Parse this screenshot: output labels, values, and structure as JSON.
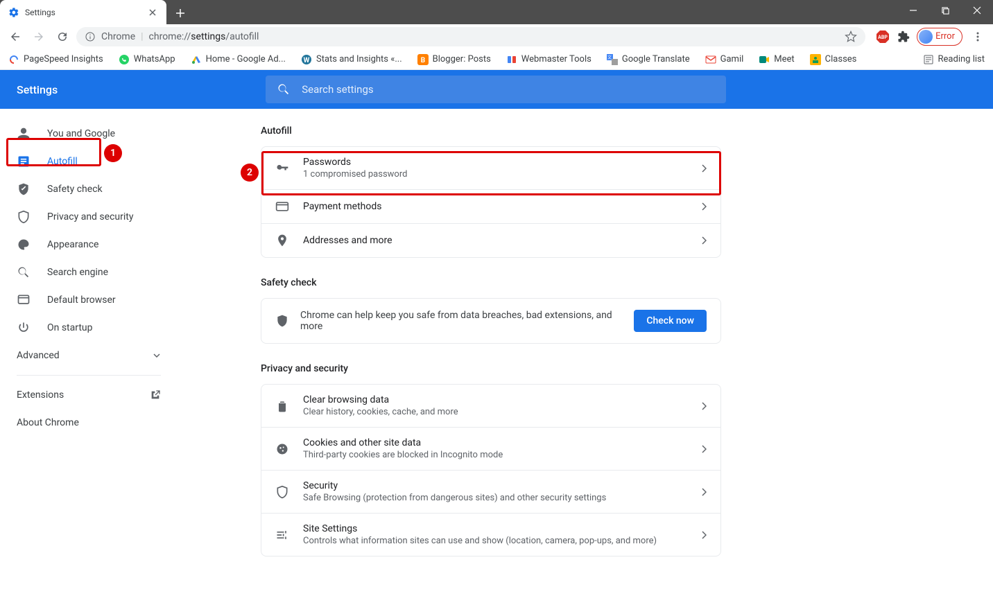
{
  "browser": {
    "tab_title": "Settings",
    "url_label": "Chrome",
    "url_prefix": "chrome://",
    "url_bold": "settings",
    "url_rest": "/autofill",
    "profile_error": "Error"
  },
  "bookmarks": [
    {
      "label": "PageSpeed Insights"
    },
    {
      "label": "WhatsApp"
    },
    {
      "label": "Home - Google Ad..."
    },
    {
      "label": "Stats and Insights «..."
    },
    {
      "label": "Blogger: Posts"
    },
    {
      "label": "Webmaster Tools"
    },
    {
      "label": "Google Translate"
    },
    {
      "label": "Gamil"
    },
    {
      "label": "Meet"
    },
    {
      "label": "Classes"
    }
  ],
  "reading_list": "Reading list",
  "header": {
    "title": "Settings",
    "search_placeholder": "Search settings"
  },
  "sidebar": {
    "items": [
      {
        "label": "You and Google"
      },
      {
        "label": "Autofill"
      },
      {
        "label": "Safety check"
      },
      {
        "label": "Privacy and security"
      },
      {
        "label": "Appearance"
      },
      {
        "label": "Search engine"
      },
      {
        "label": "Default browser"
      },
      {
        "label": "On startup"
      }
    ],
    "advanced": "Advanced",
    "extensions": "Extensions",
    "about": "About Chrome"
  },
  "sections": {
    "autofill": {
      "title": "Autofill",
      "rows": [
        {
          "title": "Passwords",
          "sub": "1 compromised password"
        },
        {
          "title": "Payment methods",
          "sub": ""
        },
        {
          "title": "Addresses and more",
          "sub": ""
        }
      ]
    },
    "safety": {
      "title": "Safety check",
      "text": "Chrome can help keep you safe from data breaches, bad extensions, and more",
      "button": "Check now"
    },
    "privacy": {
      "title": "Privacy and security",
      "rows": [
        {
          "title": "Clear browsing data",
          "sub": "Clear history, cookies, cache, and more"
        },
        {
          "title": "Cookies and other site data",
          "sub": "Third-party cookies are blocked in Incognito mode"
        },
        {
          "title": "Security",
          "sub": "Safe Browsing (protection from dangerous sites) and other security settings"
        },
        {
          "title": "Site Settings",
          "sub": "Controls what information sites can use and show (location, camera, pop-ups, and more)"
        }
      ]
    }
  },
  "annotations": {
    "a1": "1",
    "a2": "2"
  }
}
